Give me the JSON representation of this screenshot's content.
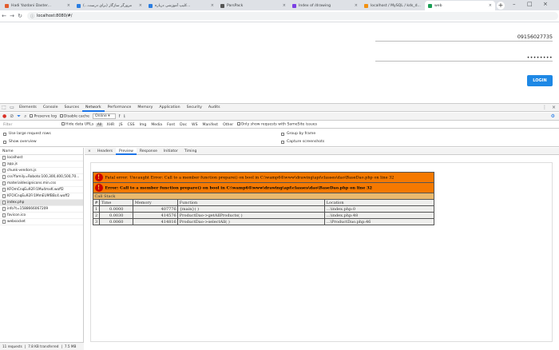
{
  "tabs": [
    {
      "title": "Hadi Yazdani Daster...",
      "color": "#e25c2d",
      "active": false
    },
    {
      "title": "مرورگر سازگار (برای درست...)",
      "color": "#2a7de1",
      "active": false
    },
    {
      "title": "کلیپ آموزشی درباره...",
      "color": "#2a7de1",
      "active": false
    },
    {
      "title": "ParsPack",
      "color": "#555555",
      "active": false
    },
    {
      "title": "Index of /drawing",
      "color": "#7b3fe4",
      "active": false
    },
    {
      "title": "localhost / MySQL / kds_d...",
      "color": "#f29111",
      "active": false
    },
    {
      "title": "web",
      "color": "#1a9e55",
      "active": true
    }
  ],
  "url": "localhost:8080/#/",
  "form": {
    "phone": "09156027735",
    "password": "••••••••",
    "login_label": "LOGIN"
  },
  "devtools": {
    "tabs": [
      "Elements",
      "Console",
      "Sources",
      "Network",
      "Performance",
      "Memory",
      "Application",
      "Security",
      "Audits"
    ],
    "active_tab": "Network",
    "toolbar": {
      "preserve_log": "Preserve log",
      "disable_cache": "Disable cache",
      "online": "Online"
    },
    "filter": {
      "placeholder": "Filter",
      "hide_data": "Hide data URLs",
      "types": [
        "All",
        "XHR",
        "JS",
        "CSS",
        "Img",
        "Media",
        "Font",
        "Doc",
        "WS",
        "Manifest",
        "Other"
      ],
      "samesite": "Only show requests with SameSite issues"
    },
    "options": {
      "large_rows": "Use large request rows",
      "overview": "Show overview",
      "group": "Group by frame",
      "screenshots": "Capture screenshots"
    },
    "name_header": "Name",
    "files": [
      "localhost",
      "app.js",
      "chunk-vendors.js",
      "css?family=Roboto:100,300,400,500,70...",
      "materialdesignicons.min.css",
      "KFOmCnqEu92Fr1Mu4mxK.woff2",
      "KFOlCnqEu92Fr1MmEU9fBBc4.woff2",
      "index.php",
      "info?t=1588666067209",
      "favicon.ico",
      "websocket"
    ],
    "selected_file": "index.php",
    "status": {
      "requests": "11 requests",
      "transferred": "7.8 KB transferred",
      "resources": "7.5 MB"
    },
    "detail_tabs": [
      "Headers",
      "Preview",
      "Response",
      "Initiator",
      "Timing"
    ],
    "active_detail": "Preview"
  },
  "error": {
    "fatal": "Fatal error: Uncaught Error: Call to a member function prepare() on bool in C:\\wamp64\\www\\drawing\\api\\classes\\dao\\BaseDao.php on line 32",
    "error": "Error: Call to a member function prepare() on bool in C:\\wamp64\\www\\drawing\\api\\classes\\dao\\BaseDao.php on line 32",
    "call_stack": "Call Stack",
    "headers": [
      "#",
      "Time",
      "Memory",
      "Function",
      "Location"
    ],
    "rows": [
      [
        "1",
        "0.0000",
        "407776",
        "{main}( )",
        "...\\index.php:0"
      ],
      [
        "2",
        "0.0030",
        "414576",
        "ProductDao->getAllProducts( )",
        "...\\index.php:48"
      ],
      [
        "3",
        "0.0060",
        "414816",
        "ProductDao->selectAll( )",
        "...\\ProductDao.php:46"
      ]
    ]
  }
}
